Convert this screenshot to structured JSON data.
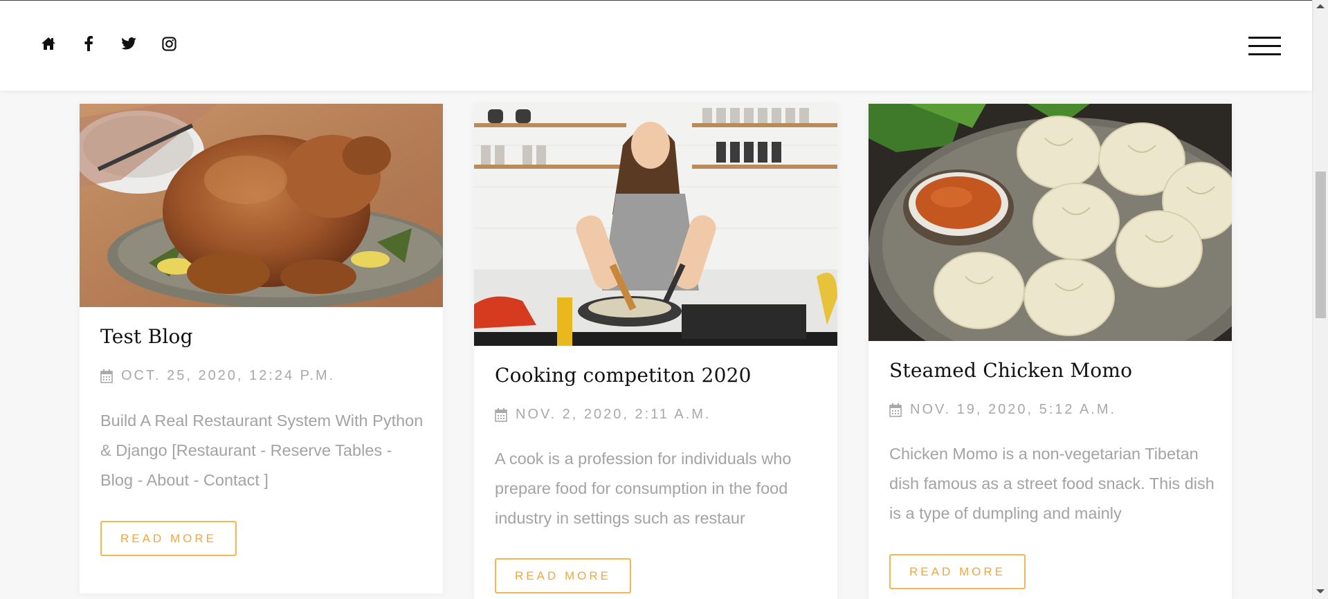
{
  "header": {
    "social_icons": [
      "home-icon",
      "facebook-icon",
      "twitter-icon",
      "instagram-icon"
    ],
    "menu_icon": "hamburger-menu-icon"
  },
  "posts": [
    {
      "title": "Test Blog",
      "date": "OCT. 25, 2020, 12:24 P.M.",
      "excerpt": "Build A Real Restaurant System With Python & Django [Restaurant - Reserve Tables - Blog - About - Contact ]",
      "button": "READ MORE",
      "image": "roast-chicken-photo"
    },
    {
      "title": "Cooking competiton 2020",
      "date": "NOV. 2, 2020, 2:11 A.M.",
      "excerpt": "A cook is a profession for individuals who prepare food for consumption in the food industry in settings such as restaur",
      "button": "READ MORE",
      "image": "woman-cooking-kitchen-photo"
    },
    {
      "title": "Steamed Chicken Momo",
      "date": "NOV. 19, 2020, 5:12 A.M.",
      "excerpt": "Chicken Momo is a non-vegetarian Tibetan dish famous as a street food snack. This dish is a type of dumpling and mainly",
      "button": "READ MORE",
      "image": "steamed-momo-photo"
    }
  ],
  "colors": {
    "accent": "#f3a73a",
    "text_dark": "#111111",
    "text_muted": "#a3a3a3",
    "background": "#f7f7f7"
  },
  "icons": {
    "date": "calendar-icon"
  }
}
